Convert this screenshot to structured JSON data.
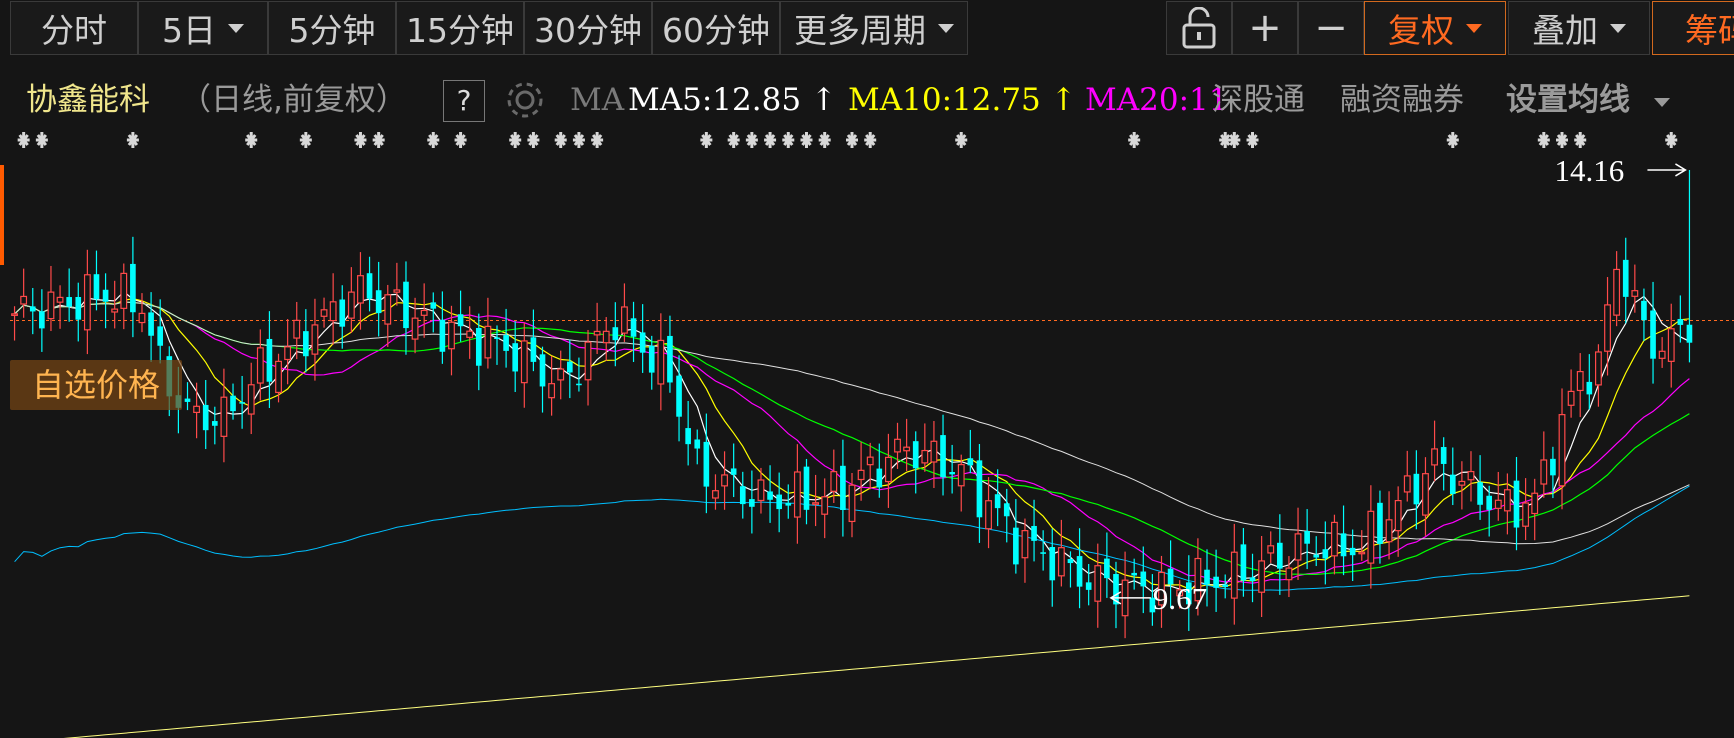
{
  "toolbar": {
    "buttons": [
      {
        "label": "分时"
      },
      {
        "label": "5日"
      },
      {
        "label": "5分钟"
      },
      {
        "label": "15分钟"
      },
      {
        "label": "30分钟"
      },
      {
        "label": "60分钟"
      },
      {
        "label": "更多周期"
      }
    ],
    "plus": "+",
    "minus": "−",
    "fuquan": "复权",
    "diejia": "叠加",
    "chouma": "筹码"
  },
  "info": {
    "stock_name": "协鑫能科",
    "period": "（日线,前复权）",
    "help": "?",
    "ma_label": "MA",
    "ma5": "MA5:12.85 ↑",
    "ma10": "MA10:12.75 ↑",
    "ma20": "MA20:11",
    "shengutong": "深股通",
    "rzrq": "融资融券",
    "set_ma": "设置均线"
  },
  "overlay": {
    "self_price": "自选价格",
    "high_label": "14.16",
    "low_label": "9.67"
  },
  "colors": {
    "up": "#ff4a4a",
    "down": "#00ffff",
    "ma5": "#ffffff",
    "ma10": "#ffff00",
    "ma20": "#ff00ff",
    "ma30": "#00ff00",
    "ma60": "#e0e0e0",
    "ma120": "#00bfff",
    "ma250": "#ffff80",
    "accent": "#ff6a21"
  },
  "chart_data": {
    "type": "candlestick",
    "high": 14.16,
    "low": 9.67,
    "ylim": [
      8.2,
      14.6
    ],
    "reference_price": 12.58,
    "events_count": 40
  }
}
